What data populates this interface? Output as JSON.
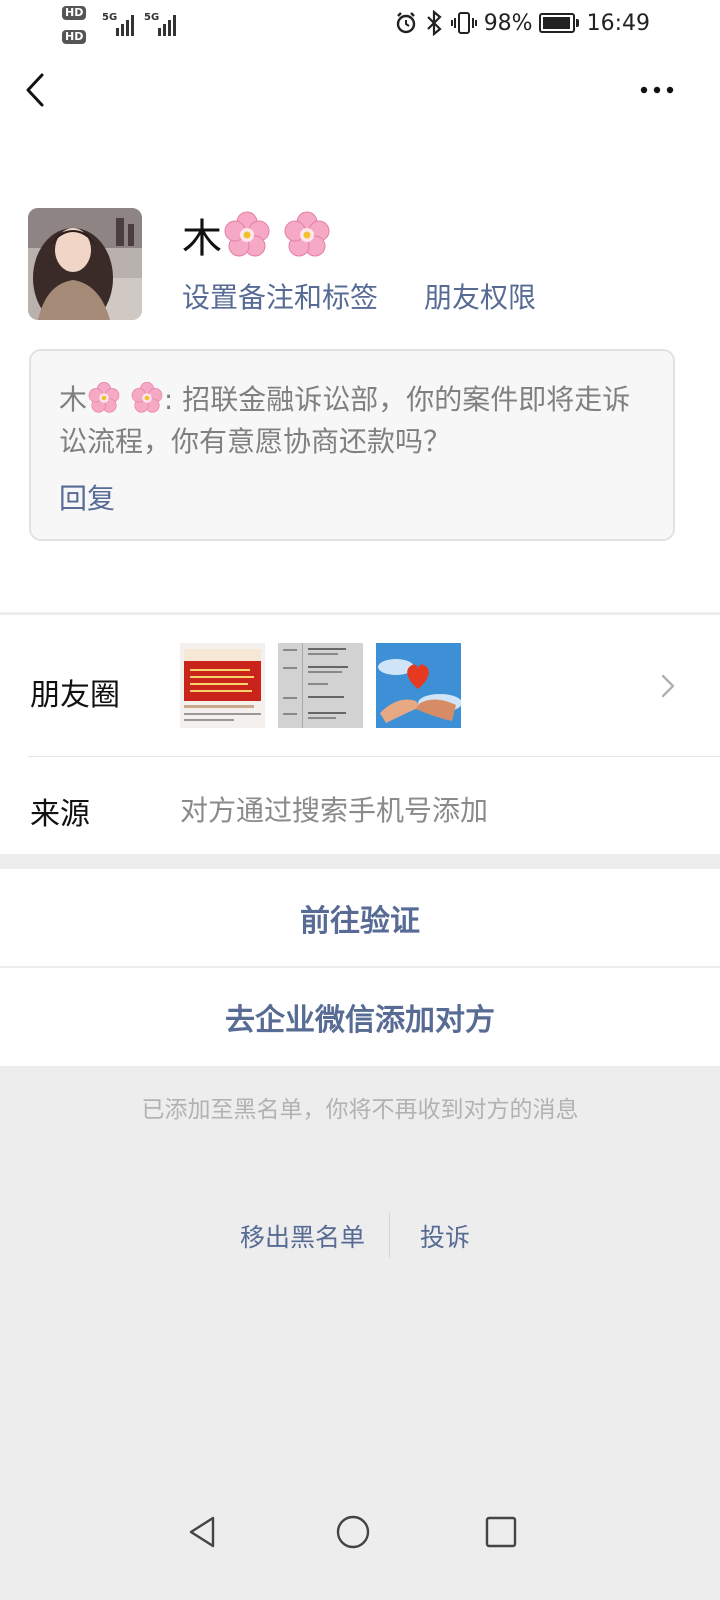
{
  "status_bar": {
    "hd1": "HD",
    "hd2": "HD",
    "net1": "5G",
    "net2": "5G",
    "battery_text": "98%",
    "battery_level": 0.98,
    "time": "16:49"
  },
  "nav": {
    "back_icon": "chevron-left-icon",
    "more_icon": "more-horizontal-icon"
  },
  "profile": {
    "nickname": "木",
    "remark_link": "设置备注和标签",
    "permission_link": "朋友权限"
  },
  "verify_message": {
    "sender": "木",
    "text": ": 招联金融诉讼部，你的案件即将走诉讼流程，你有意愿协商还款吗？",
    "reply_label": "回复"
  },
  "moments": {
    "label": "朋友圈"
  },
  "source": {
    "label": "来源",
    "value": "对方通过搜索手机号添加"
  },
  "actions": {
    "verify": "前往验证",
    "wework_add": "去企业微信添加对方"
  },
  "blacklist_note": "已添加至黑名单，你将不再收到对方的消息",
  "footer": {
    "remove_blacklist": "移出黑名单",
    "complain": "投诉"
  },
  "colors": {
    "link": "#576b95",
    "background": "#ededed"
  }
}
